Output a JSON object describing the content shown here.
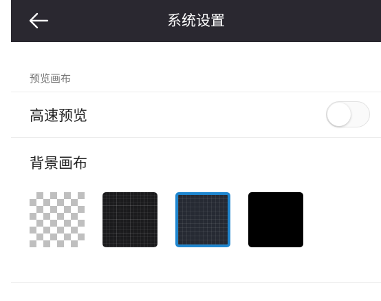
{
  "header": {
    "title": "系统设置",
    "back_icon": "arrow-left-icon",
    "background_color": "#2a2830"
  },
  "preview_section": {
    "label": "预览画布"
  },
  "fast_preview": {
    "label": "高速预览",
    "toggle_on": false
  },
  "background_canvas": {
    "label": "背景画布",
    "options": [
      {
        "name": "transparent-checker",
        "selected": false
      },
      {
        "name": "dark-grid",
        "selected": false
      },
      {
        "name": "navy-grid",
        "selected": true
      },
      {
        "name": "solid-black",
        "selected": false
      }
    ],
    "selected_color": "#1f86cf"
  }
}
